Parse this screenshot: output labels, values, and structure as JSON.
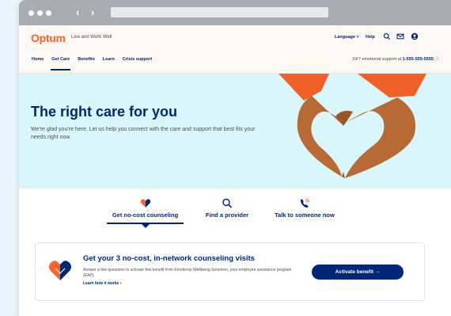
{
  "header": {
    "logo": "Optum",
    "tagline": "Live and Work Well",
    "language_label": "Language",
    "help_label": "Help",
    "nav": [
      "Home",
      "Get Care",
      "Benefits",
      "Learn",
      "Crisis support"
    ],
    "active_nav": "Get Care",
    "support_text": "24/7 emotional support at",
    "support_phone": "1-555-555-5555"
  },
  "hero": {
    "title": "The right care for you",
    "subtitle": "We're glad you're here. Let us help you connect with the care and support that best fits your needs right now."
  },
  "tabs": [
    {
      "label": "Get no-cost counseling",
      "icon": "heart-hands-icon"
    },
    {
      "label": "Find a provider",
      "icon": "magnifier-icon"
    },
    {
      "label": "Talk to someone now",
      "icon": "phone-icon"
    }
  ],
  "card": {
    "title": "Get your 3 no-cost, in-network counseling visits",
    "description": "Answer a few questions to activate this benefit from Emotional Wellbeing Solutions, your employee assistance program (EAP).",
    "link": "Learn how it works",
    "cta": "Activate benefit"
  },
  "colors": {
    "brand_orange": "#ff612b",
    "navy": "#002677",
    "hero_bg": "#d9f6fa",
    "skin_tone": "#b86a35"
  }
}
